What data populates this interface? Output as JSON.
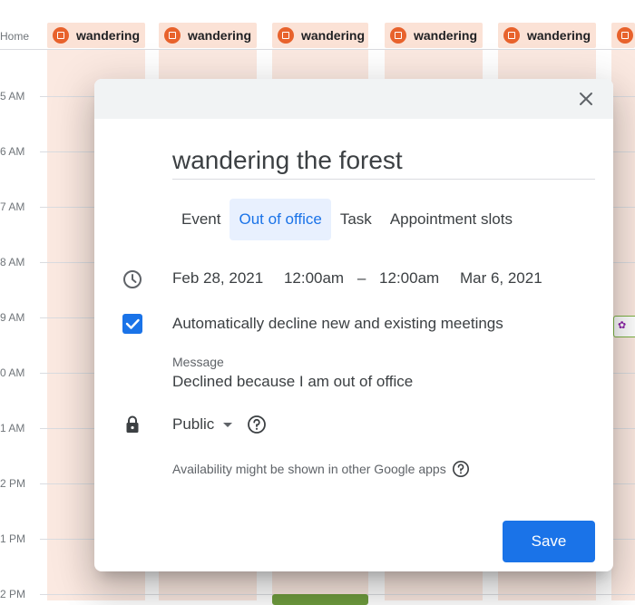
{
  "calendar": {
    "home_label": "Home",
    "time_labels": [
      "5 AM",
      "6 AM",
      "7 AM",
      "8 AM",
      "9 AM",
      "0 AM",
      "1 AM",
      "2 PM",
      "1 PM",
      "2 PM"
    ],
    "chip_title": "wandering"
  },
  "dialog": {
    "title": "wandering the forest",
    "tabs": [
      "Event",
      "Out of office",
      "Task",
      "Appointment slots"
    ],
    "active_tab": "Out of office",
    "start_date": "Feb 28, 2021",
    "start_time": "12:00am",
    "dash": "–",
    "end_time": "12:00am",
    "end_date": "Mar 6, 2021",
    "auto_decline_label": "Automatically decline new and existing meetings",
    "auto_decline_checked": true,
    "message_label": "Message",
    "message_value": "Declined because I am out of office",
    "visibility_value": "Public",
    "availability_note": "Availability might be shown in other Google apps",
    "save_label": "Save"
  },
  "icons": {
    "close": "close-icon",
    "clock": "clock-icon",
    "checkbox": "checkbox-checked-icon",
    "lock": "lock-icon",
    "help": "help-circle-icon",
    "dropdown": "dropdown-arrow-icon"
  },
  "colors": {
    "accent": "#1a73e8",
    "ooo_event": "#e8622c",
    "ooo_background": "#fbe9e1"
  }
}
